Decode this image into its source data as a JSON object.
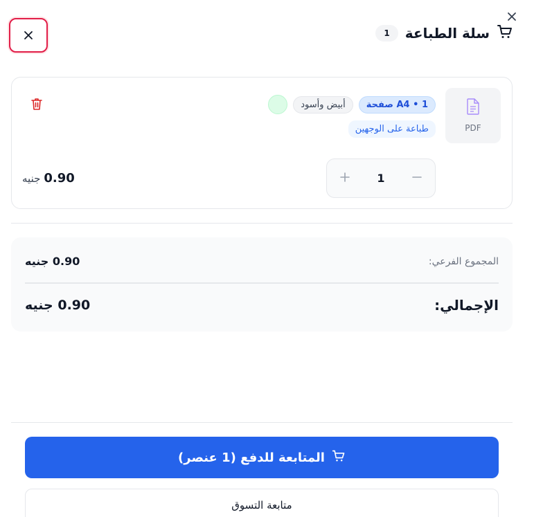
{
  "cart": {
    "title": "سلة الطباعة",
    "count": "1"
  },
  "item": {
    "file_type": "PDF",
    "pages_tag": "1 • A4 صفحة",
    "color_tag": "أبيض وأسود",
    "duplex_tag": "طباعة على الوجهين",
    "quantity": "1",
    "price_value": "0.90",
    "currency": "جنيه"
  },
  "summary": {
    "subtotal_label": "المجموع الفرعي:",
    "subtotal_value": "0.90 جنيه",
    "total_label": "الإجمالي:",
    "total_value": "0.90 جنيه"
  },
  "actions": {
    "checkout_label": "المتابعة للدفع (1 عنصر)",
    "continue_label": "متابعة التسوق"
  },
  "colors": {
    "primary": "#2563eb",
    "danger": "#e11d48",
    "swatch": "#dcfce7"
  }
}
